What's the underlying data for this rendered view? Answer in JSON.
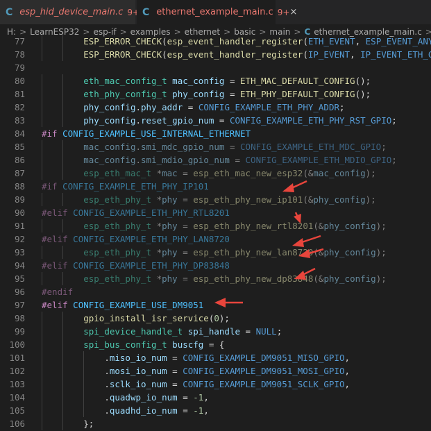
{
  "tabs": [
    {
      "icon": "C",
      "label": "esp_hid_device_main.c",
      "badge": "9+",
      "active": false
    },
    {
      "icon": "C",
      "label": "ethernet_example_main.c",
      "badge": "9+",
      "active": true,
      "close": "×"
    }
  ],
  "breadcrumb": {
    "items": [
      "H:",
      "LearnESP32",
      "esp-if",
      "examples",
      "ethernet",
      "basic",
      "main"
    ],
    "file_icon": "C",
    "file": "ethernet_example_main.c",
    "separator": ">",
    "tail": "..."
  },
  "lines": [
    {
      "n": "77",
      "segs": [
        [
          "ind",
          "        "
        ],
        [
          "fn",
          "ESP_ERROR_CHECK"
        ],
        [
          "p",
          "("
        ],
        [
          "fn",
          "esp_event_handler_register"
        ],
        [
          "p",
          "("
        ],
        [
          "mc",
          "ETH_EVENT"
        ],
        [
          "p",
          ", "
        ],
        [
          "mc",
          "ESP_EVENT_ANY_I"
        ]
      ]
    },
    {
      "n": "78",
      "segs": [
        [
          "ind",
          "        "
        ],
        [
          "fn",
          "ESP_ERROR_CHECK"
        ],
        [
          "p",
          "("
        ],
        [
          "fn",
          "esp_event_handler_register"
        ],
        [
          "p",
          "("
        ],
        [
          "mc",
          "IP_EVENT"
        ],
        [
          "p",
          ", "
        ],
        [
          "mc",
          "IP_EVENT_ETH_GOT"
        ]
      ]
    },
    {
      "n": "79",
      "segs": []
    },
    {
      "n": "80",
      "segs": [
        [
          "ind",
          "        "
        ],
        [
          "ty",
          "eth_mac_config_t"
        ],
        [
          "p",
          " "
        ],
        [
          "va",
          "mac_config"
        ],
        [
          "p",
          " = "
        ],
        [
          "fn",
          "ETH_MAC_DEFAULT_CONFIG"
        ],
        [
          "p",
          "();"
        ]
      ]
    },
    {
      "n": "81",
      "segs": [
        [
          "ind",
          "        "
        ],
        [
          "ty",
          "eth_phy_config_t"
        ],
        [
          "p",
          " "
        ],
        [
          "va",
          "phy_config"
        ],
        [
          "p",
          " = "
        ],
        [
          "fn",
          "ETH_PHY_DEFAULT_CONFIG"
        ],
        [
          "p",
          "();"
        ]
      ]
    },
    {
      "n": "82",
      "segs": [
        [
          "ind",
          "        "
        ],
        [
          "va",
          "phy_config"
        ],
        [
          "p",
          "."
        ],
        [
          "va",
          "phy_addr"
        ],
        [
          "p",
          " = "
        ],
        [
          "mc",
          "CONFIG_EXAMPLE_ETH_PHY_ADDR"
        ],
        [
          "p",
          ";"
        ]
      ]
    },
    {
      "n": "83",
      "segs": [
        [
          "ind",
          "        "
        ],
        [
          "va",
          "phy_config"
        ],
        [
          "p",
          "."
        ],
        [
          "va",
          "reset_gpio_num"
        ],
        [
          "p",
          " = "
        ],
        [
          "mc",
          "CONFIG_EXAMPLE_ETH_PHY_RST_GPIO"
        ],
        [
          "p",
          ";"
        ]
      ]
    },
    {
      "n": "84",
      "segs": [
        [
          "kw",
          "#if"
        ],
        [
          "p",
          " "
        ],
        [
          "co",
          "CONFIG_EXAMPLE_USE_INTERNAL_ETHERNET"
        ]
      ]
    },
    {
      "n": "85",
      "dim": true,
      "segs": [
        [
          "ind",
          "        "
        ],
        [
          "va",
          "mac_config"
        ],
        [
          "p",
          "."
        ],
        [
          "va",
          "smi_mdc_gpio_num"
        ],
        [
          "p",
          " = "
        ],
        [
          "mc",
          "CONFIG_EXAMPLE_ETH_MDC_GPIO"
        ],
        [
          "p",
          ";"
        ]
      ]
    },
    {
      "n": "86",
      "dim": true,
      "segs": [
        [
          "ind",
          "        "
        ],
        [
          "va",
          "mac_config"
        ],
        [
          "p",
          "."
        ],
        [
          "va",
          "smi_mdio_gpio_num"
        ],
        [
          "p",
          " = "
        ],
        [
          "mc",
          "CONFIG_EXAMPLE_ETH_MDIO_GPIO"
        ],
        [
          "p",
          ";"
        ]
      ]
    },
    {
      "n": "87",
      "dim": true,
      "segs": [
        [
          "ind",
          "        "
        ],
        [
          "ty",
          "esp_eth_mac_t"
        ],
        [
          "p",
          " *"
        ],
        [
          "va",
          "mac"
        ],
        [
          "p",
          " = "
        ],
        [
          "fn",
          "esp_eth_mac_new_esp32"
        ],
        [
          "p",
          "(&"
        ],
        [
          "va",
          "mac_config"
        ],
        [
          "p",
          ");"
        ]
      ]
    },
    {
      "n": "88",
      "dim": true,
      "segs": [
        [
          "kw",
          "#if"
        ],
        [
          "p",
          " "
        ],
        [
          "co",
          "CONFIG_EXAMPLE_ETH_PHY_IP101"
        ]
      ]
    },
    {
      "n": "89",
      "dim": true,
      "segs": [
        [
          "ind",
          "        "
        ],
        [
          "ty",
          "esp_eth_phy_t"
        ],
        [
          "p",
          " *"
        ],
        [
          "va",
          "phy"
        ],
        [
          "p",
          " = "
        ],
        [
          "fn",
          "esp_eth_phy_new_ip101"
        ],
        [
          "p",
          "(&"
        ],
        [
          "va",
          "phy_config"
        ],
        [
          "p",
          ");"
        ]
      ]
    },
    {
      "n": "90",
      "dim": true,
      "segs": [
        [
          "kw",
          "#elif"
        ],
        [
          "p",
          " "
        ],
        [
          "co",
          "CONFIG_EXAMPLE_ETH_PHY_RTL8201"
        ]
      ]
    },
    {
      "n": "91",
      "dim": true,
      "segs": [
        [
          "ind",
          "        "
        ],
        [
          "ty",
          "esp_eth_phy_t"
        ],
        [
          "p",
          " *"
        ],
        [
          "va",
          "phy"
        ],
        [
          "p",
          " = "
        ],
        [
          "fn",
          "esp_eth_phy_new_rtl8201"
        ],
        [
          "p",
          "(&"
        ],
        [
          "va",
          "phy_config"
        ],
        [
          "p",
          ");"
        ]
      ]
    },
    {
      "n": "92",
      "dim": true,
      "segs": [
        [
          "kw",
          "#elif"
        ],
        [
          "p",
          " "
        ],
        [
          "co",
          "CONFIG_EXAMPLE_ETH_PHY_LAN8720"
        ]
      ]
    },
    {
      "n": "93",
      "dim": true,
      "segs": [
        [
          "ind",
          "        "
        ],
        [
          "ty",
          "esp_eth_phy_t"
        ],
        [
          "p",
          " *"
        ],
        [
          "va",
          "phy"
        ],
        [
          "p",
          " = "
        ],
        [
          "fn",
          "esp_eth_phy_new_lan8720"
        ],
        [
          "p",
          "(&"
        ],
        [
          "va",
          "phy_config"
        ],
        [
          "p",
          ");"
        ]
      ]
    },
    {
      "n": "94",
      "dim": true,
      "segs": [
        [
          "kw",
          "#elif"
        ],
        [
          "p",
          " "
        ],
        [
          "co",
          "CONFIG_EXAMPLE_ETH_PHY_DP83848"
        ]
      ]
    },
    {
      "n": "95",
      "dim": true,
      "segs": [
        [
          "ind",
          "        "
        ],
        [
          "ty",
          "esp_eth_phy_t"
        ],
        [
          "p",
          " *"
        ],
        [
          "va",
          "phy"
        ],
        [
          "p",
          " = "
        ],
        [
          "fn",
          "esp_eth_phy_new_dp83848"
        ],
        [
          "p",
          "(&"
        ],
        [
          "va",
          "phy_config"
        ],
        [
          "p",
          ");"
        ]
      ]
    },
    {
      "n": "96",
      "dim": true,
      "segs": [
        [
          "kw",
          "#endif"
        ]
      ]
    },
    {
      "n": "97",
      "segs": [
        [
          "kw",
          "#elif"
        ],
        [
          "p",
          " "
        ],
        [
          "co",
          "CONFIG_EXAMPLE_USE_DM9051"
        ]
      ]
    },
    {
      "n": "98",
      "segs": [
        [
          "ind",
          "        "
        ],
        [
          "fn",
          "gpio_install_isr_service"
        ],
        [
          "p",
          "("
        ],
        [
          "nu",
          "0"
        ],
        [
          "p",
          ");"
        ]
      ]
    },
    {
      "n": "99",
      "segs": [
        [
          "ind",
          "        "
        ],
        [
          "ty",
          "spi_device_handle_t"
        ],
        [
          "p",
          " "
        ],
        [
          "va",
          "spi_handle"
        ],
        [
          "p",
          " = "
        ],
        [
          "mc",
          "NULL"
        ],
        [
          "p",
          ";"
        ]
      ]
    },
    {
      "n": "100",
      "segs": [
        [
          "ind",
          "        "
        ],
        [
          "ty",
          "spi_bus_config_t"
        ],
        [
          "p",
          " "
        ],
        [
          "va",
          "buscfg"
        ],
        [
          "p",
          " = {"
        ]
      ]
    },
    {
      "n": "101",
      "segs": [
        [
          "ind",
          "            "
        ],
        [
          "p",
          "."
        ],
        [
          "va",
          "miso_io_num"
        ],
        [
          "p",
          " = "
        ],
        [
          "mc",
          "CONFIG_EXAMPLE_DM9051_MISO_GPIO"
        ],
        [
          "p",
          ","
        ]
      ]
    },
    {
      "n": "102",
      "segs": [
        [
          "ind",
          "            "
        ],
        [
          "p",
          "."
        ],
        [
          "va",
          "mosi_io_num"
        ],
        [
          "p",
          " = "
        ],
        [
          "mc",
          "CONFIG_EXAMPLE_DM9051_MOSI_GPIO"
        ],
        [
          "p",
          ","
        ]
      ]
    },
    {
      "n": "103",
      "segs": [
        [
          "ind",
          "            "
        ],
        [
          "p",
          "."
        ],
        [
          "va",
          "sclk_io_num"
        ],
        [
          "p",
          " = "
        ],
        [
          "mc",
          "CONFIG_EXAMPLE_DM9051_SCLK_GPIO"
        ],
        [
          "p",
          ","
        ]
      ]
    },
    {
      "n": "104",
      "segs": [
        [
          "ind",
          "            "
        ],
        [
          "p",
          "."
        ],
        [
          "va",
          "quadwp_io_num"
        ],
        [
          "p",
          " = "
        ],
        [
          "nu",
          "-1"
        ],
        [
          "p",
          ","
        ]
      ]
    },
    {
      "n": "105",
      "segs": [
        [
          "ind",
          "            "
        ],
        [
          "p",
          "."
        ],
        [
          "va",
          "quadhd_io_num"
        ],
        [
          "p",
          " = "
        ],
        [
          "nu",
          "-1"
        ],
        [
          "p",
          ","
        ]
      ]
    },
    {
      "n": "106",
      "segs": [
        [
          "ind",
          "        "
        ],
        [
          "p",
          "};"
        ]
      ]
    }
  ],
  "annotation_color": "#e8453c"
}
